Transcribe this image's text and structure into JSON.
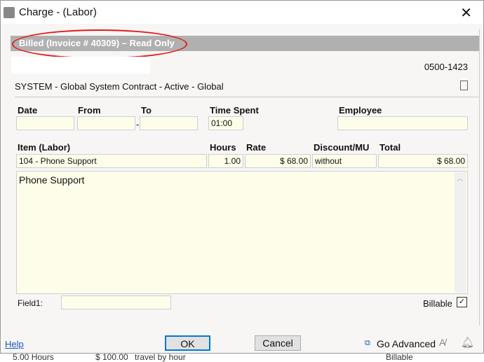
{
  "window": {
    "title": "Charge - (Labor)"
  },
  "banner": "Billed (Invoice # 40309) – Read Only",
  "code": "0500-1423",
  "contract": "SYSTEM - Global System Contract - Active -  Global",
  "labels": {
    "date": "Date",
    "from": "From",
    "to": "To",
    "time_spent": "Time Spent",
    "employee": "Employee",
    "item": "Item  (Labor)",
    "hours": "Hours",
    "rate": "Rate",
    "discount": "Discount/MU",
    "total": "Total",
    "field1": "Field1:",
    "billable": "Billable"
  },
  "values": {
    "date": "",
    "from": "",
    "to": "",
    "dash": "-",
    "time_spent": "01:00",
    "employee": "",
    "item": "104 - Phone Support",
    "hours": "1.00",
    "rate": "$ 68.00",
    "discount": "without",
    "total": "$ 68.00",
    "description": "Phone Support",
    "field1": "",
    "billable": "✓"
  },
  "footer": {
    "help": "Help",
    "ok": "OK",
    "cancel": "Cancel",
    "go_advanced": "Go Advanced"
  },
  "background_row": {
    "hours": "5.00 Hours",
    "rate": "$ 100.00",
    "desc": "travel by hour",
    "billable": "Billable"
  }
}
